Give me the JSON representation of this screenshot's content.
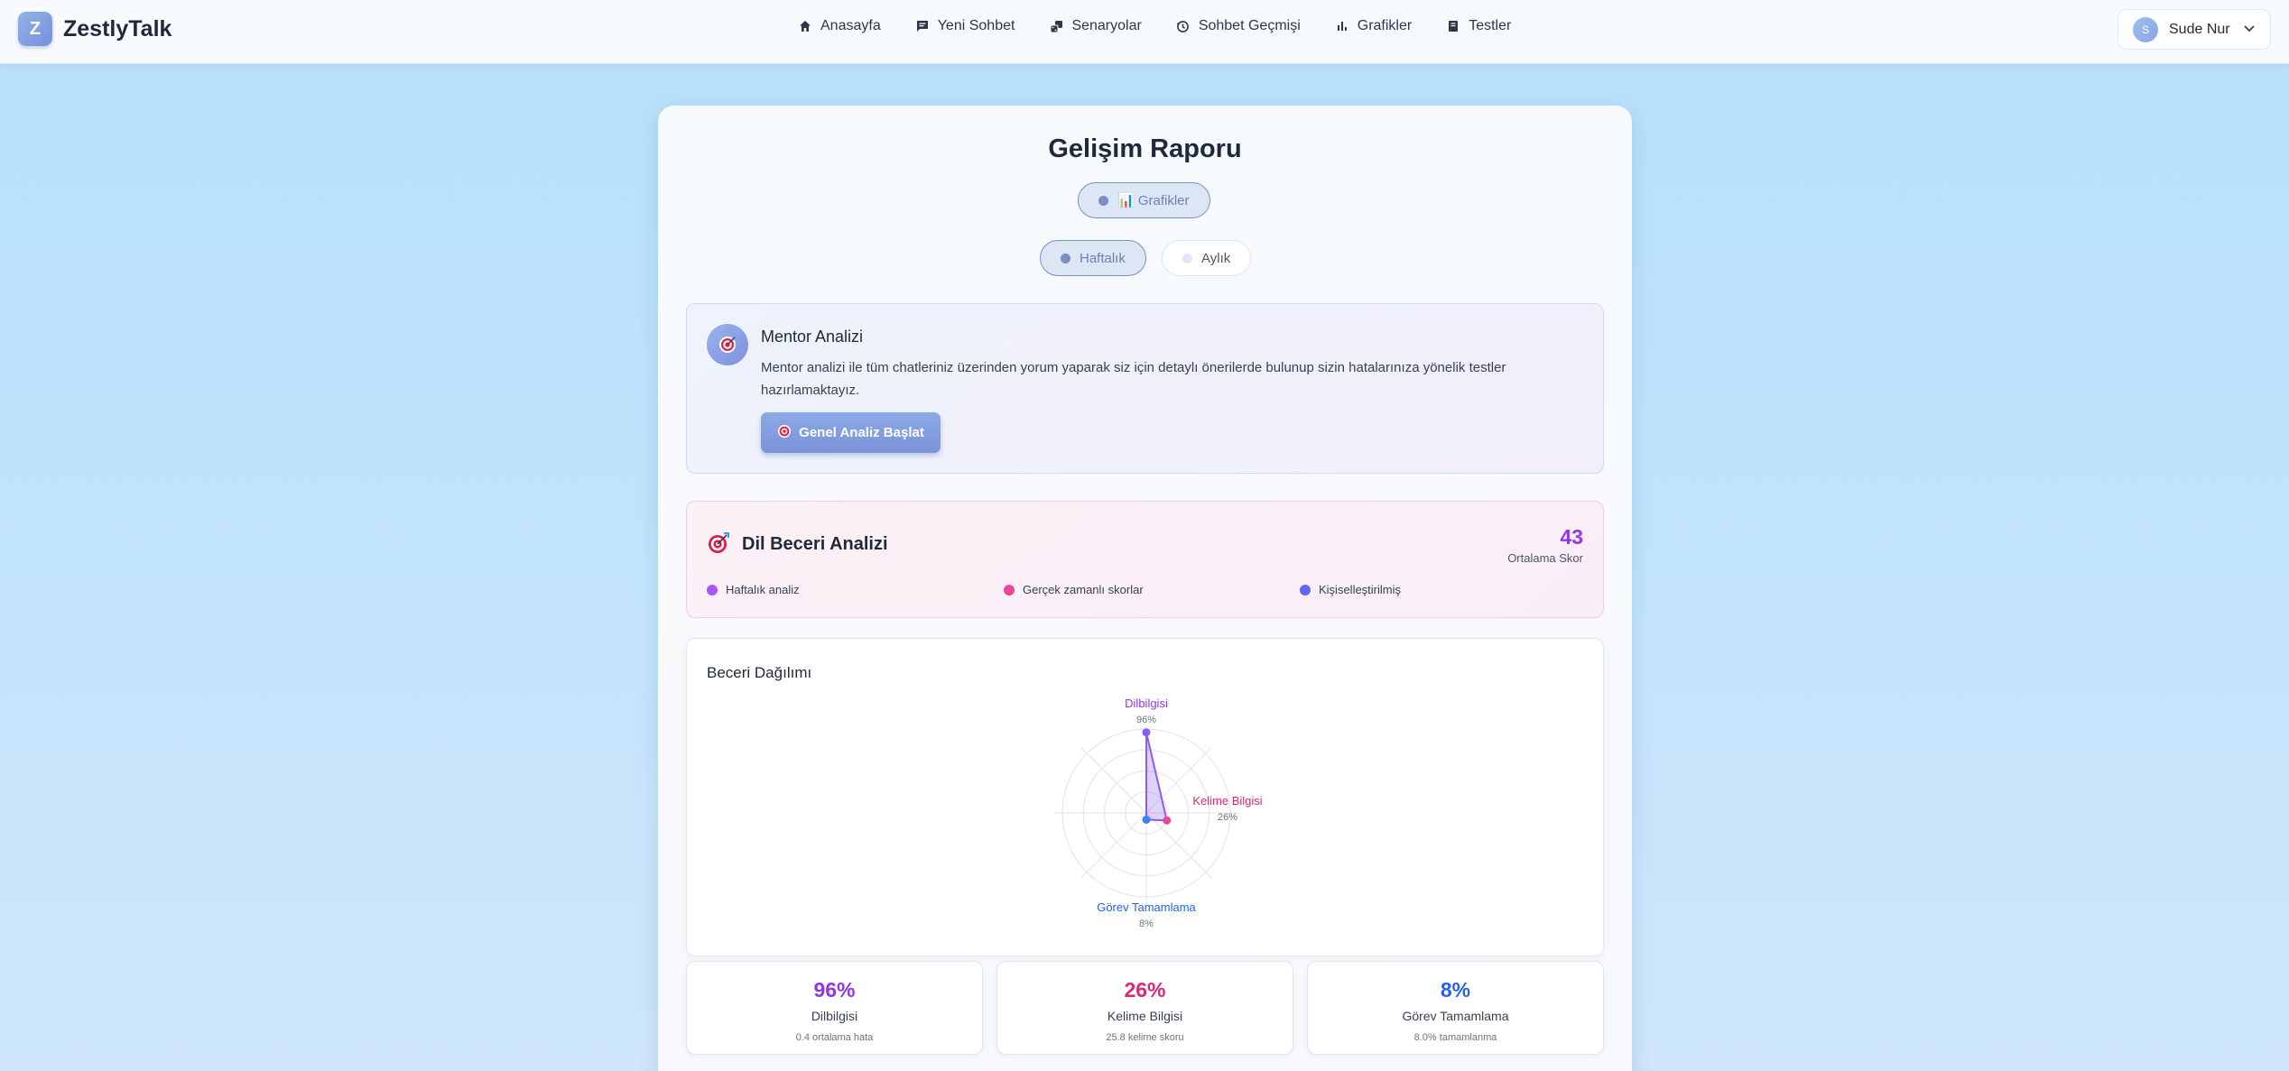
{
  "brand": {
    "logo_letter": "Z",
    "name": "ZestlyTalk"
  },
  "nav": {
    "items": [
      {
        "label": "Anasayfa",
        "icon": "home-icon"
      },
      {
        "label": "Yeni Sohbet",
        "icon": "chat-icon"
      },
      {
        "label": "Senaryolar",
        "icon": "dice-icon"
      },
      {
        "label": "Sohbet Geçmişi",
        "icon": "history-icon"
      },
      {
        "label": "Grafikler",
        "icon": "bar-chart-icon"
      },
      {
        "label": "Testler",
        "icon": "book-icon"
      }
    ]
  },
  "user": {
    "initial": "S",
    "name": "Sude Nur"
  },
  "page": {
    "title": "Gelişim Raporu",
    "view_toggle": {
      "label": "📊 Grafikler"
    },
    "period": {
      "weekly": "Haftalık",
      "monthly": "Aylık",
      "selected": "Haftalık"
    }
  },
  "mentor": {
    "title": "Mentor Analizi",
    "description": "Mentor analizi ile tüm chatleriniz üzerinden yorum yaparak siz için detaylı önerilerde bulunup sizin hatalarınıza yönelik testler hazırlamaktayız.",
    "button": "Genel Analiz Başlat"
  },
  "skill_analysis": {
    "title": "Dil Beceri Analizi",
    "score": "43",
    "score_label": "Ortalama Skor",
    "tags": [
      {
        "label": "Haftalık analiz",
        "color": "#a855f7"
      },
      {
        "label": "Gerçek zamanlı skorlar",
        "color": "#ec4899"
      },
      {
        "label": "Kişiselleştirilmiş",
        "color": "#6366f1"
      }
    ]
  },
  "distribution": {
    "title": "Beceri Dağılımı"
  },
  "chart_data": {
    "type": "radar",
    "categories": [
      "Dilbilgisi",
      "Kelime Bilgisi",
      "Görev Tamamlama"
    ],
    "values": [
      96,
      26,
      8
    ],
    "value_labels": [
      "96%",
      "26%",
      "8%"
    ],
    "colors": [
      "#9333ea",
      "#db2777",
      "#2563eb"
    ],
    "range": [
      0,
      100
    ]
  },
  "stats": [
    {
      "value": "96%",
      "label": "Dilbilgisi",
      "sub": "0.4 ortalama hata",
      "color": "#9333ea"
    },
    {
      "value": "26%",
      "label": "Kelime Bilgisi",
      "sub": "25.8 kelime skoru",
      "color": "#db2777"
    },
    {
      "value": "8%",
      "label": "Görev Tamamlama",
      "sub": "8.0% tamamlanma",
      "color": "#2563eb"
    }
  ]
}
